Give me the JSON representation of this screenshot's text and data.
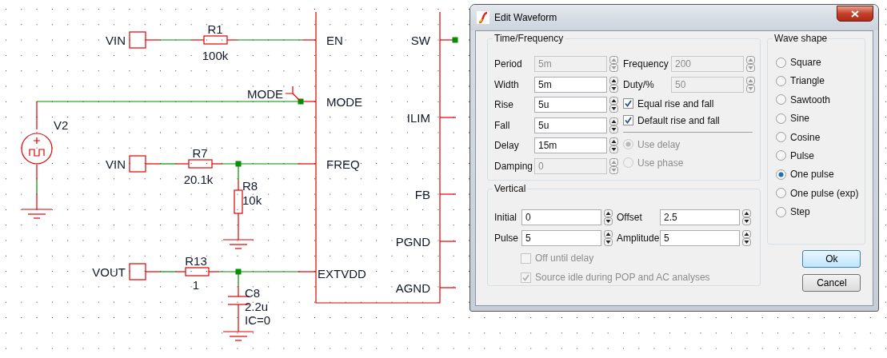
{
  "schematic": {
    "ports": [
      {
        "label": "VIN"
      },
      {
        "label": "VIN"
      },
      {
        "label": "VOUT"
      }
    ],
    "components": [
      {
        "ref": "R1",
        "value": "100k"
      },
      {
        "ref": "R7",
        "value": "20.1k"
      },
      {
        "ref": "R8",
        "value": "10k"
      },
      {
        "ref": "R13",
        "value": "1"
      },
      {
        "ref": "C8",
        "value": "2.2u",
        "initial_condition": "IC=0"
      },
      {
        "ref": "V2"
      }
    ],
    "net_label": "MODE",
    "ic_pins_left": [
      "EN",
      "MODE",
      "FREQ",
      "EXTVDD"
    ],
    "ic_pins_right": [
      "SW",
      "ILIM",
      "FB",
      "PGND",
      "AGND"
    ]
  },
  "dialog": {
    "title": "Edit Waveform",
    "time_frequency": {
      "title": "Time/Frequency",
      "fields": [
        {
          "label": "Period",
          "value": "5m",
          "disabled": true
        },
        {
          "label": "Width",
          "value": "5m",
          "disabled": false
        },
        {
          "label": "Rise",
          "value": "5u",
          "disabled": false
        },
        {
          "label": "Fall",
          "value": "5u",
          "disabled": false
        },
        {
          "label": "Delay",
          "value": "15m",
          "disabled": false
        },
        {
          "label": "Damping",
          "value": "0",
          "disabled": true
        }
      ],
      "right_fields": [
        {
          "label": "Frequency",
          "value": "200",
          "disabled": true
        },
        {
          "label": "Duty/%",
          "value": "50",
          "disabled": true
        }
      ],
      "checkboxes": [
        {
          "label": "Equal rise and fall",
          "checked": true,
          "disabled": false
        },
        {
          "label": "Default rise and fall",
          "checked": true,
          "disabled": false
        }
      ],
      "radios": [
        {
          "label": "Use delay",
          "selected": true,
          "disabled": true
        },
        {
          "label": "Use phase",
          "selected": false,
          "disabled": true
        }
      ]
    },
    "vertical": {
      "title": "Vertical",
      "fields": [
        {
          "label": "Initial",
          "value": "0",
          "disabled": false
        },
        {
          "label": "Offset",
          "value": "2.5",
          "disabled": false
        },
        {
          "label": "Pulse",
          "value": "5",
          "disabled": false
        },
        {
          "label": "Amplitude",
          "value": "5",
          "disabled": false
        }
      ],
      "checkboxes": [
        {
          "label": "Off until delay",
          "checked": false,
          "disabled": true
        },
        {
          "label": "Source idle during POP and AC analyses",
          "checked": true,
          "disabled": true
        }
      ]
    },
    "wave_shape": {
      "title": "Wave shape",
      "options": [
        {
          "label": "Square",
          "selected": false
        },
        {
          "label": "Triangle",
          "selected": false
        },
        {
          "label": "Sawtooth",
          "selected": false
        },
        {
          "label": "Sine",
          "selected": false
        },
        {
          "label": "Cosine",
          "selected": false
        },
        {
          "label": "Pulse",
          "selected": false
        },
        {
          "label": "One pulse",
          "selected": true
        },
        {
          "label": "One pulse (exp)",
          "selected": false
        },
        {
          "label": "Step",
          "selected": false
        }
      ]
    },
    "buttons": [
      {
        "label": "Ok",
        "default": true
      },
      {
        "label": "Cancel",
        "default": false
      }
    ]
  }
}
